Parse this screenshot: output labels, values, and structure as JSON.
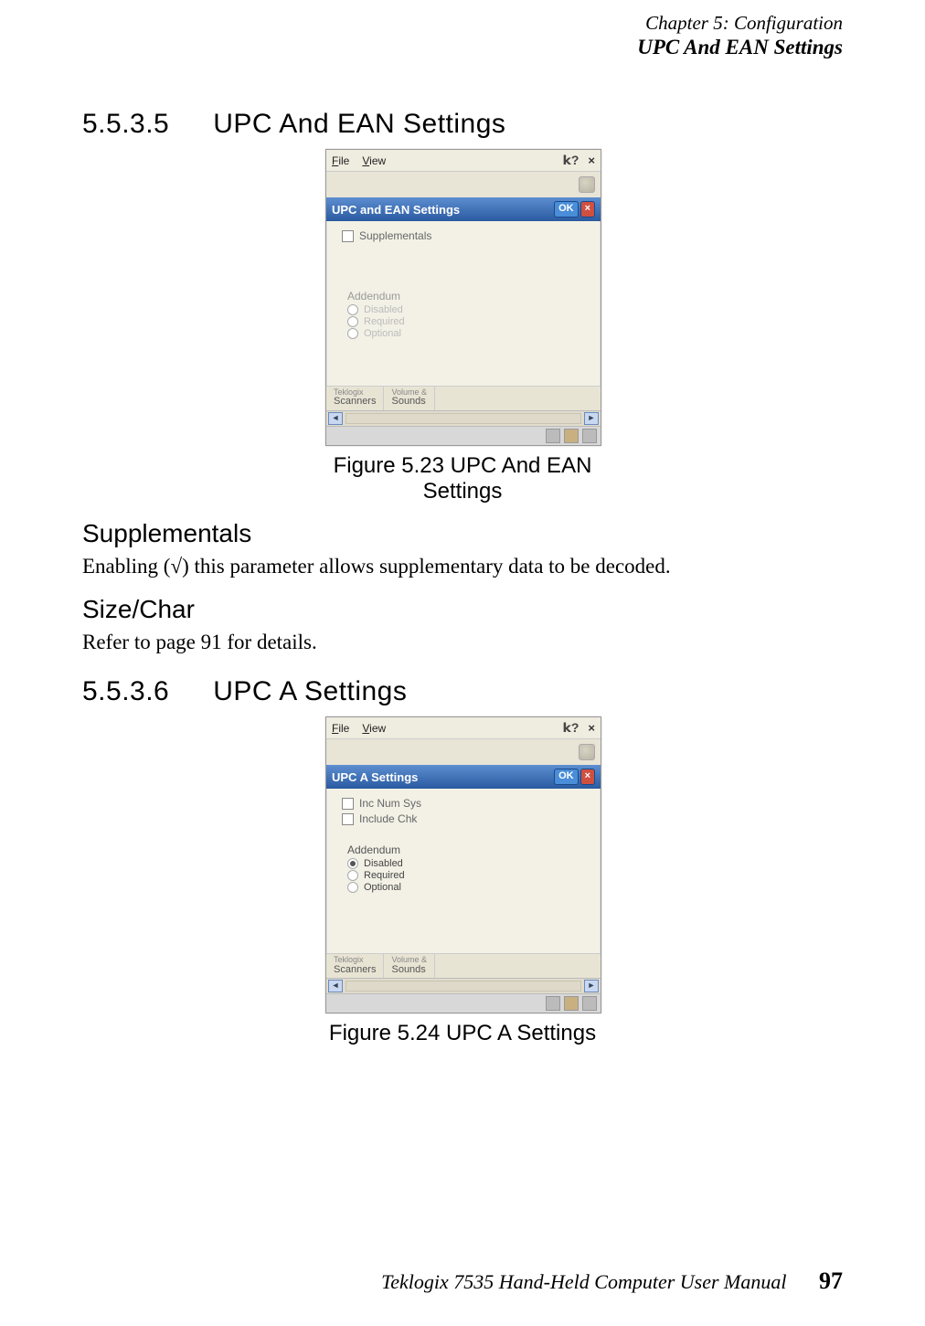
{
  "header": {
    "chapter": "Chapter 5: Configuration",
    "section": "UPC And EAN Settings"
  },
  "section1": {
    "number": "5.5.3.5",
    "title": "UPC And EAN Settings",
    "figure_caption": "Figure 5.23 UPC And EAN Settings",
    "supplementals_heading": "Supplementals",
    "supplementals_body": "Enabling (√) this parameter allows supplementary data to be decoded.",
    "sizechar_heading": "Size/Char",
    "sizechar_body": "Refer to page 91 for details.",
    "shot": {
      "menu_file": "File",
      "menu_view": "View",
      "help": "?",
      "close": "×",
      "title": "UPC and EAN Settings",
      "ok": "OK",
      "x": "×",
      "chk1": "Supplementals",
      "addendum": "Addendum",
      "r1": "Disabled",
      "r2": "Required",
      "r3": "Optional",
      "tab1_small": "Teklogix",
      "tab1": "Scanners",
      "tab2_small": "Volume &",
      "tab2": "Sounds"
    }
  },
  "section2": {
    "number": "5.5.3.6",
    "title": "UPC A Settings",
    "figure_caption": "Figure 5.24 UPC A Settings",
    "shot": {
      "menu_file": "File",
      "menu_view": "View",
      "help": "?",
      "close": "×",
      "title": "UPC A Settings",
      "ok": "OK",
      "x": "×",
      "chk1": "Inc Num Sys",
      "chk2": "Include Chk",
      "addendum": "Addendum",
      "r1": "Disabled",
      "r2": "Required",
      "r3": "Optional",
      "tab1_small": "Teklogix",
      "tab1": "Scanners",
      "tab2_small": "Volume &",
      "tab2": "Sounds"
    }
  },
  "footer": {
    "manual": "Teklogix 7535 Hand-Held Computer User Manual",
    "page": "97"
  }
}
